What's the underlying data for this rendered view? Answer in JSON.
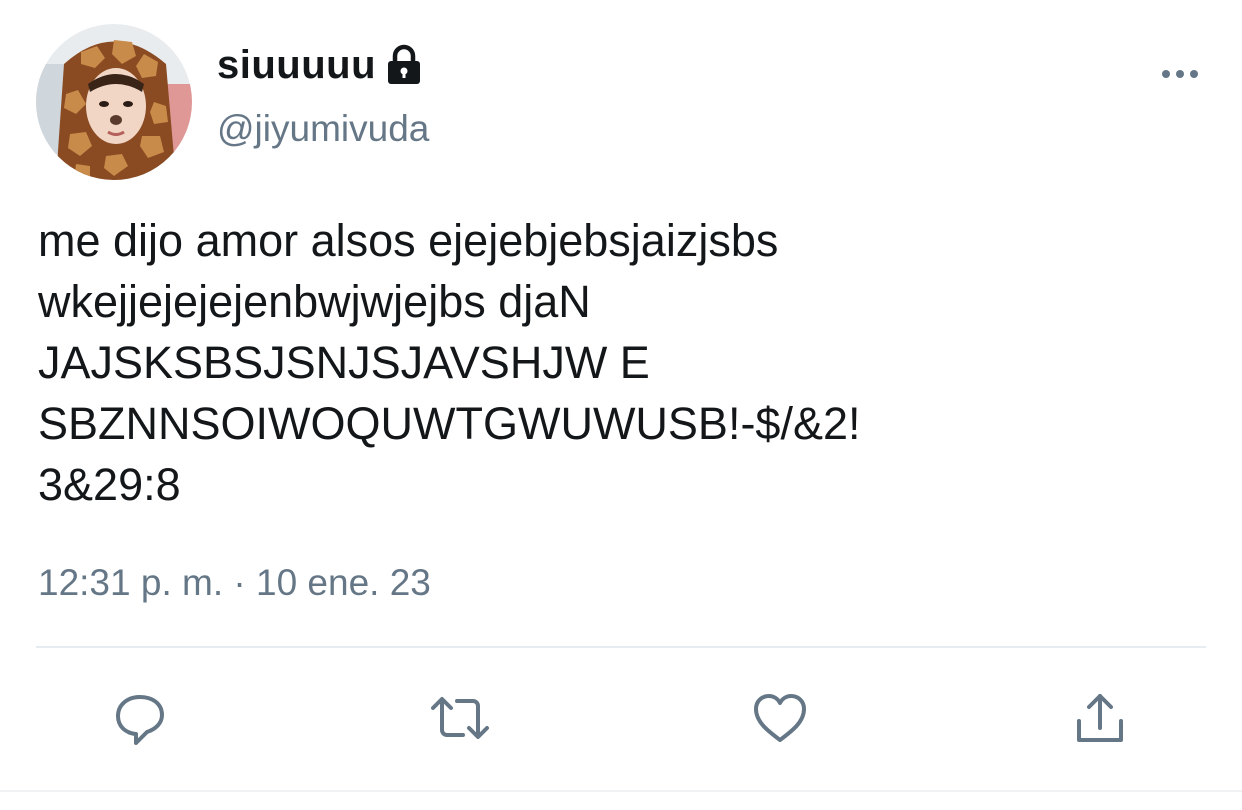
{
  "tweet": {
    "display_name": "siuuuuu",
    "handle": "@jiyumivuda",
    "text": "me dijo amor alsos ejejebjebsjaizjsbs\nwkejjejejejenbwjwjejbs djaN\nJAJSKSBSJSNJSJAVSHJW E\nSBZNNSOIWOQUWTGWUWUSB!-$/&2!\n3&29:8",
    "time": "12:31 p. m.",
    "separator": " · ",
    "date": "10 ene. 23",
    "protected": true
  },
  "icons": {
    "lock": "lock-icon",
    "more": "more-horizontal-icon",
    "reply": "reply-icon",
    "retweet": "retweet-icon",
    "like": "heart-icon",
    "share": "share-icon"
  },
  "colors": {
    "text": "#14171a",
    "secondary": "#657786",
    "icon": "#657786",
    "divider": "#e6ecf0"
  }
}
